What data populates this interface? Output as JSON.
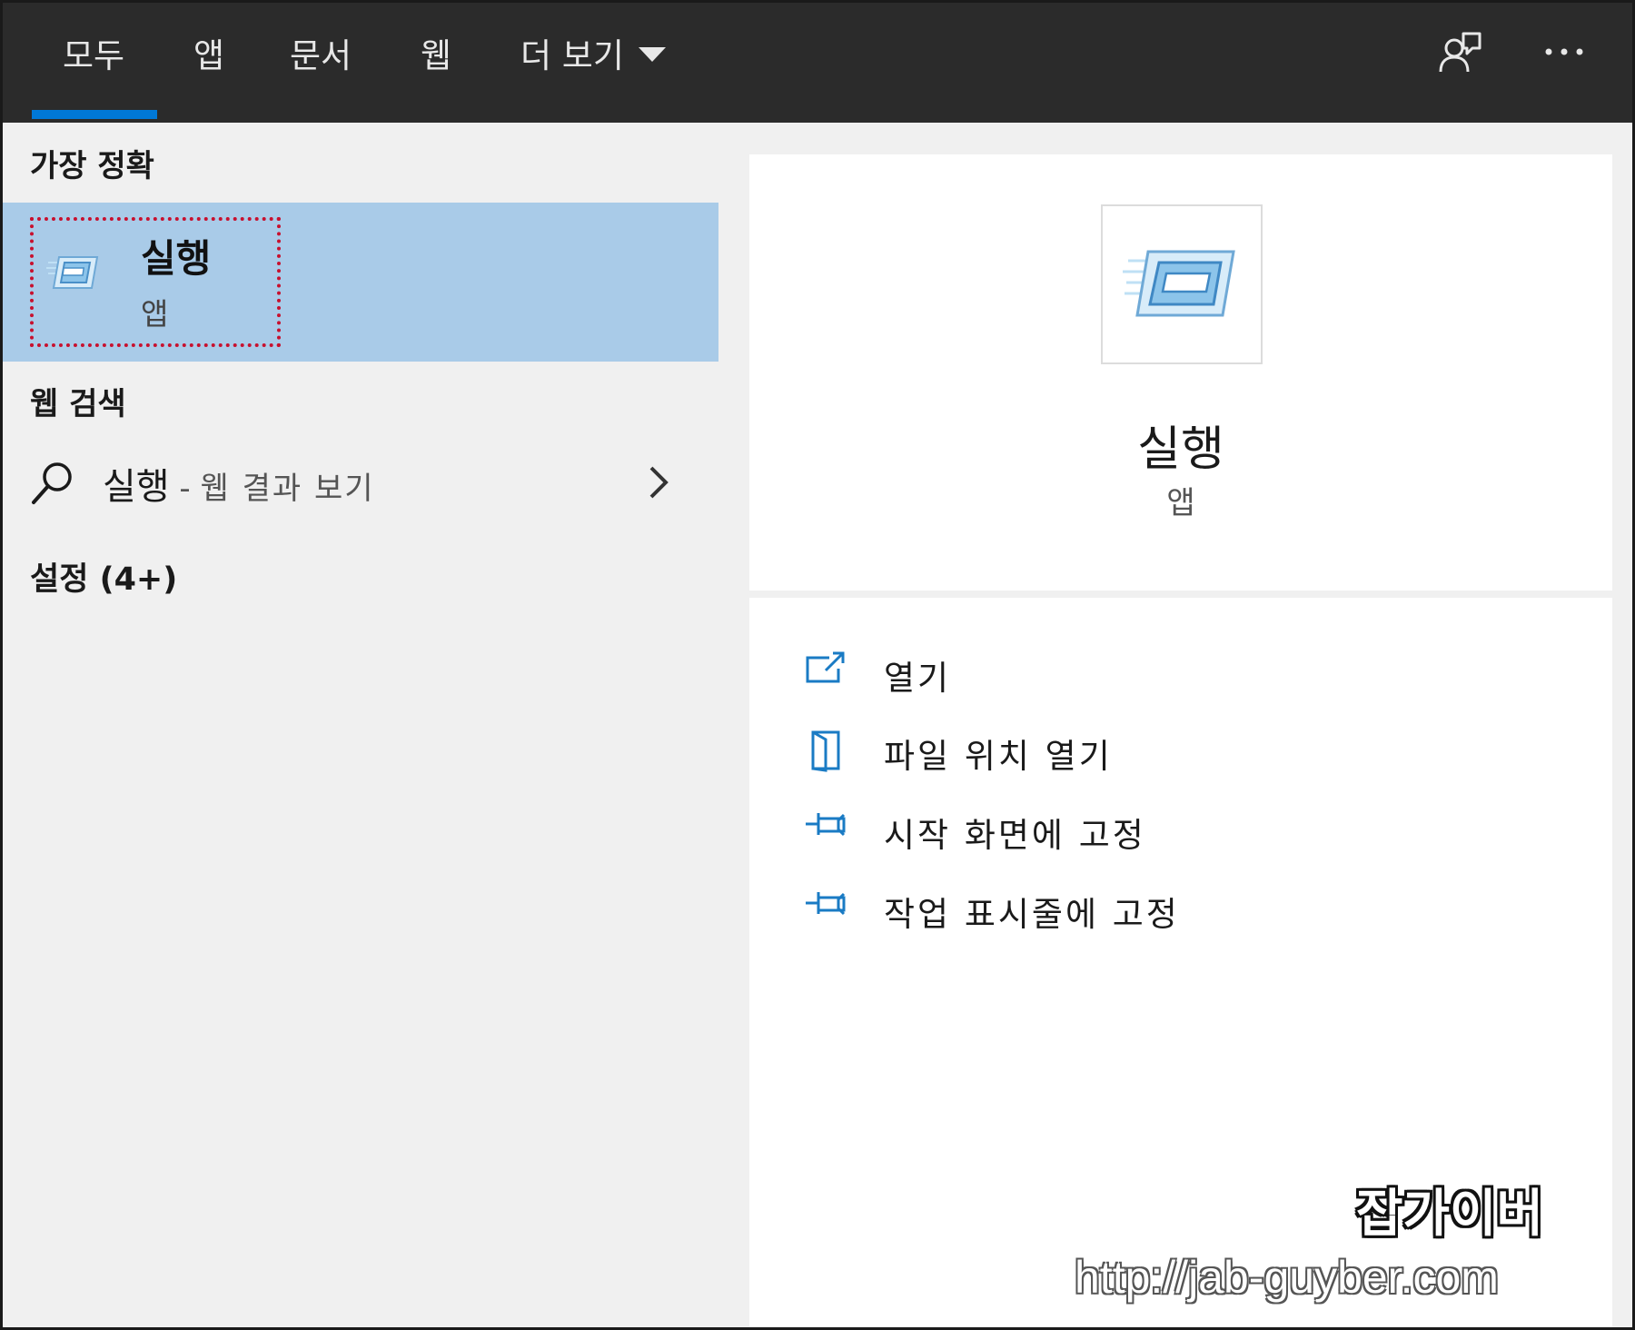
{
  "tabs": [
    {
      "label": "모두",
      "active": true
    },
    {
      "label": "앱"
    },
    {
      "label": "문서"
    },
    {
      "label": "웹"
    },
    {
      "label": "더 보기"
    }
  ],
  "top_icons": [
    "feedback-icon",
    "more-icon"
  ],
  "left": {
    "best_match_heading": "가장 정확",
    "best_match": {
      "title": "실행",
      "subtitle": "앱",
      "icon": "run-dialog-icon"
    },
    "web_heading": "웹 검색",
    "web_result": {
      "query": "실행",
      "separator": " - ",
      "suffix": "웹 결과 보기"
    },
    "settings_heading": "설정 (4+)"
  },
  "right": {
    "app_title": "실행",
    "app_subtitle": "앱",
    "actions": [
      {
        "label": "열기",
        "icon": "open-icon"
      },
      {
        "label": "파일 위치 열기",
        "icon": "file-location-icon"
      },
      {
        "label": "시작 화면에 고정",
        "icon": "pin-icon"
      },
      {
        "label": "작업 표시줄에 고정",
        "icon": "pin-icon"
      }
    ]
  },
  "watermark": {
    "name": "잡가이버",
    "url": "http://jab-guyber.com"
  },
  "colors": {
    "topbar": "#2b2b2b",
    "accent": "#0078d7",
    "selection": "#a9cbe8",
    "highlight_box": "#c8102e",
    "action_icon": "#1a7bc4"
  }
}
